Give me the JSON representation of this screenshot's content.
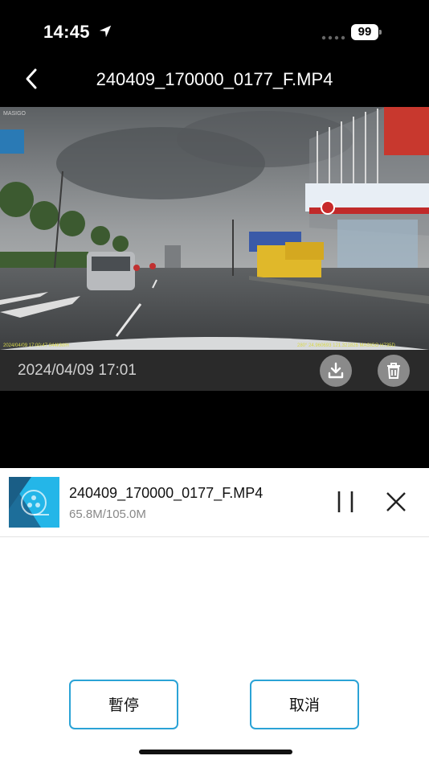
{
  "status_bar": {
    "time": "14:45",
    "battery": "99"
  },
  "header": {
    "title": "240409_170000_0177_F.MP4"
  },
  "video": {
    "brand_top": "MASIGO",
    "overlay_left": "2024/04/09 17:00:47 044KM/H",
    "overlay_right": "280°   24.960693   121.321826   MASIGO H735D",
    "date": "2024/04/09 17:01"
  },
  "download": {
    "file_name": "240409_170000_0177_F.MP4",
    "size": "65.8M/105.0M",
    "progress": 0.627
  },
  "buttons": {
    "pause": "暫停",
    "cancel": "取消"
  },
  "colors": {
    "accent": "#2ba3d6",
    "background_top": "#000000"
  },
  "icons": {
    "location": "location-arrow-icon",
    "back": "chevron-left-icon",
    "download": "download-icon",
    "delete": "trash-icon",
    "pause": "pause-icon",
    "close": "close-icon"
  }
}
